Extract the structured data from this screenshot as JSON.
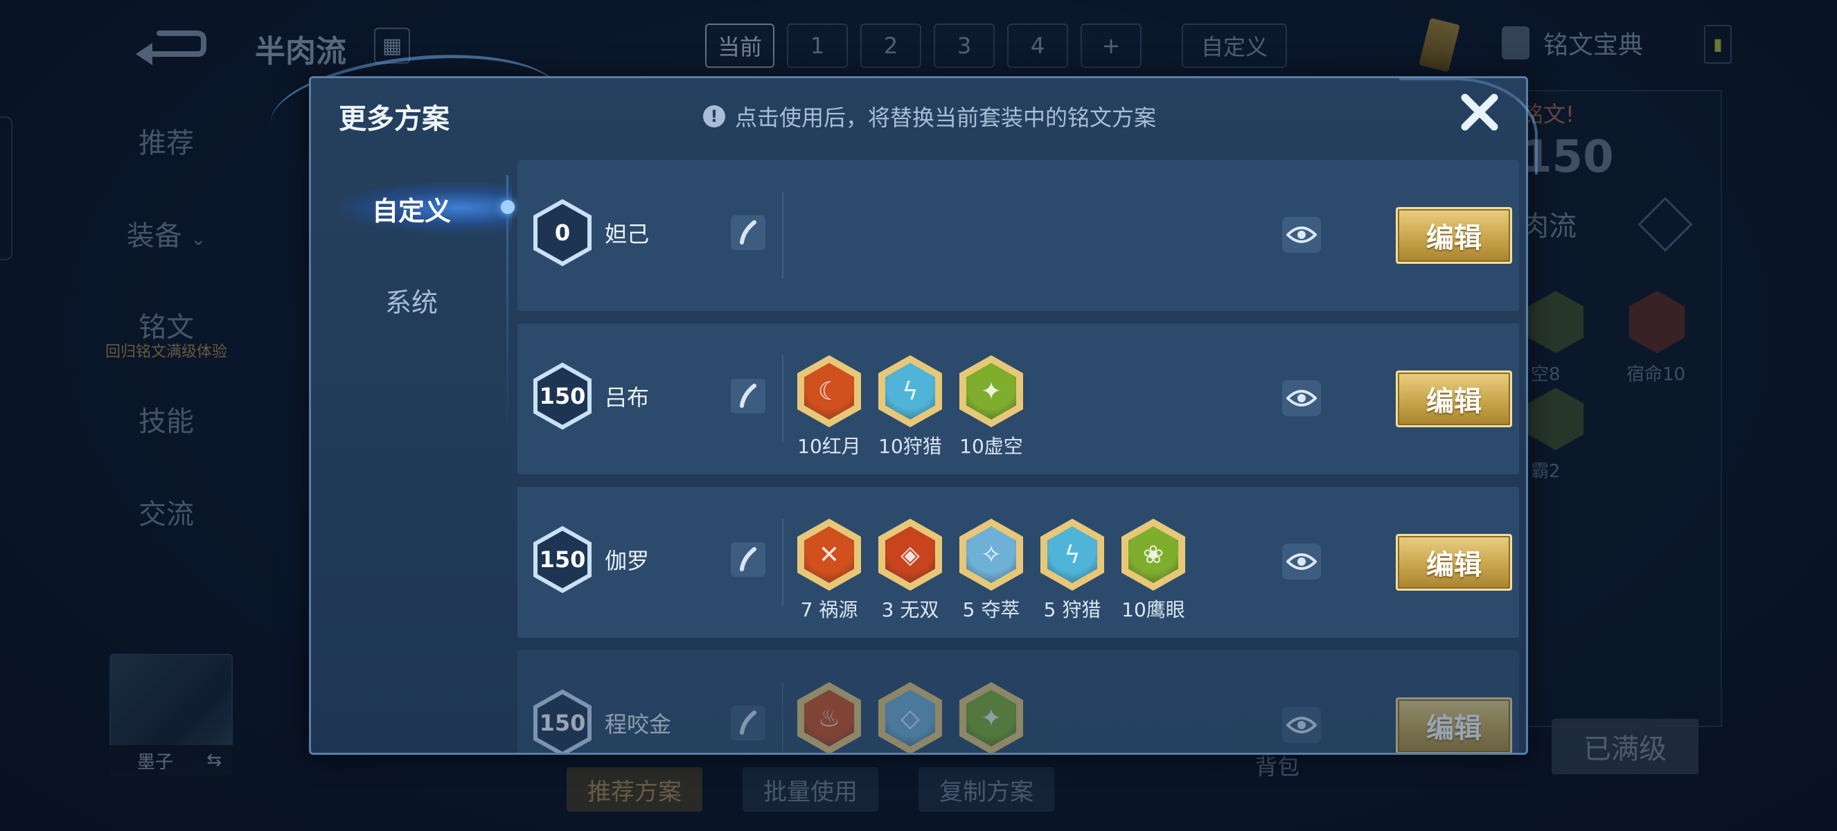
{
  "background": {
    "title": "半肉流",
    "page_tabs": [
      "当前",
      "1",
      "2",
      "3",
      "4",
      "+"
    ],
    "custom_tab": "自定义",
    "codex_label": "铭文宝典",
    "side_nav": [
      {
        "label": "推荐"
      },
      {
        "label": "装备"
      },
      {
        "label": "铭文",
        "sub": "回归铭文满级体验"
      },
      {
        "label": "技能"
      },
      {
        "label": "交流"
      }
    ],
    "hero_name": "墨子",
    "bottom_buttons": [
      "推荐方案",
      "批量使用",
      "复制方案"
    ],
    "bag_label": "背包",
    "maxed_label": "已满级",
    "right_panel": {
      "hint": "铭文!",
      "score": "150",
      "name": "肉流",
      "runes": [
        "空8",
        "宿命10",
        "霸2"
      ]
    }
  },
  "modal": {
    "title": "更多方案",
    "notice": "点击使用后，将替换当前套装中的铭文方案",
    "nav": [
      {
        "label": "自定义",
        "active": true
      },
      {
        "label": "系统",
        "active": false
      }
    ],
    "edit_label": "编辑",
    "rows": [
      {
        "level": "0",
        "name": "妲己",
        "runes": []
      },
      {
        "level": "150",
        "name": "吕布",
        "runes": [
          {
            "label": "10红月",
            "color": "#d0501e",
            "glyph": "☾"
          },
          {
            "label": "10狩猎",
            "color": "#4fb4d8",
            "glyph": "ϟ"
          },
          {
            "label": "10虚空",
            "color": "#7fae2e",
            "glyph": "✦"
          }
        ]
      },
      {
        "level": "150",
        "name": "伽罗",
        "runes": [
          {
            "label": "7 祸源",
            "color": "#d0501e",
            "glyph": "✕"
          },
          {
            "label": "3 无双",
            "color": "#c8441e",
            "glyph": "◈"
          },
          {
            "label": "5 夺萃",
            "color": "#6fb0d6",
            "glyph": "✧"
          },
          {
            "label": "5 狩猎",
            "color": "#4fb4d8",
            "glyph": "ϟ"
          },
          {
            "label": "10鹰眼",
            "color": "#7fae2e",
            "glyph": "❀"
          }
        ]
      },
      {
        "level": "150",
        "name": "程咬金",
        "runes": [
          {
            "label": "",
            "color": "#d0501e",
            "glyph": "♨"
          },
          {
            "label": "",
            "color": "#6fb0d6",
            "glyph": "◇"
          },
          {
            "label": "",
            "color": "#7fae2e",
            "glyph": "✦"
          }
        ]
      }
    ]
  }
}
